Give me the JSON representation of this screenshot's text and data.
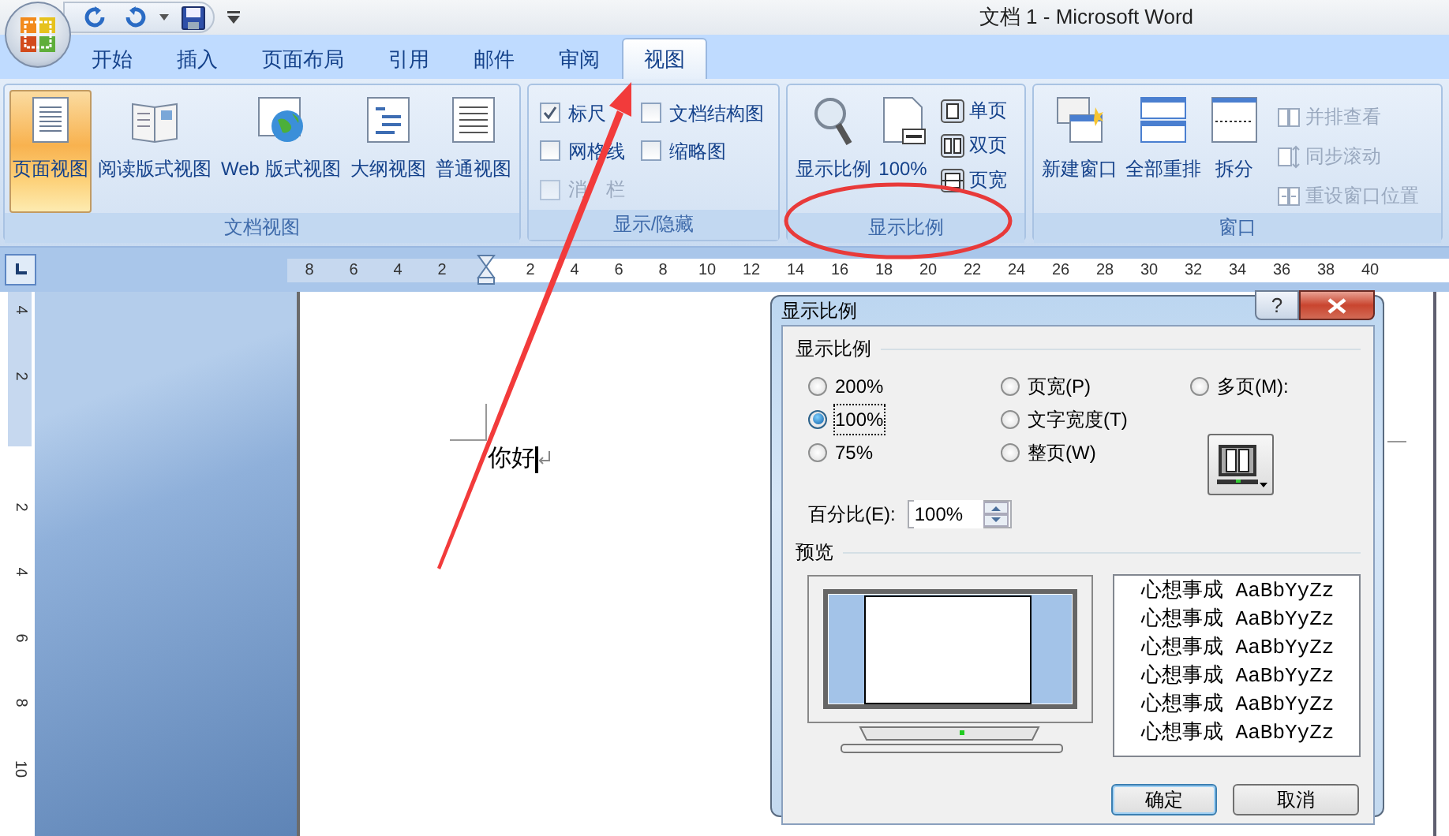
{
  "window": {
    "title": "文档 1 - Microsoft Word"
  },
  "tabs": [
    {
      "label": "开始",
      "selected": false
    },
    {
      "label": "插入",
      "selected": false
    },
    {
      "label": "页面布局",
      "selected": false
    },
    {
      "label": "引用",
      "selected": false
    },
    {
      "label": "邮件",
      "selected": false
    },
    {
      "label": "审阅",
      "selected": false
    },
    {
      "label": "视图",
      "selected": true
    }
  ],
  "ribbon": {
    "groups": [
      {
        "label": "文档视图",
        "items": [
          {
            "kind": "large",
            "label": "页面视图",
            "selected": true
          },
          {
            "kind": "large",
            "label": "阅读版式视图",
            "selected": false
          },
          {
            "kind": "large",
            "label": "Web 版式视图",
            "selected": false
          },
          {
            "kind": "large",
            "label": "大纲视图",
            "selected": false
          },
          {
            "kind": "large",
            "label": "普通视图",
            "selected": false
          }
        ]
      },
      {
        "label": "显示/隐藏",
        "items": [
          {
            "kind": "checkbox",
            "label": "标尺",
            "checked": true,
            "disabled": false
          },
          {
            "kind": "checkbox",
            "label": "文档结构图",
            "checked": false,
            "disabled": false
          },
          {
            "kind": "checkbox",
            "label": "网格线",
            "checked": false,
            "disabled": false
          },
          {
            "kind": "checkbox",
            "label": "缩略图",
            "checked": false,
            "disabled": false
          },
          {
            "kind": "checkbox",
            "label": "消　栏",
            "checked": false,
            "disabled": true
          }
        ]
      },
      {
        "label": "显示比例",
        "items": [
          {
            "kind": "large",
            "label": "显示比例"
          },
          {
            "kind": "large",
            "label": "100%"
          },
          {
            "kind": "small",
            "label": "单页"
          },
          {
            "kind": "small",
            "label": "双页"
          },
          {
            "kind": "small",
            "label": "页宽"
          }
        ]
      },
      {
        "label": "窗口",
        "items": [
          {
            "kind": "large",
            "label": "新建窗口",
            "disabled": false
          },
          {
            "kind": "large",
            "label": "全部重排",
            "disabled": false
          },
          {
            "kind": "large",
            "label": "拆分",
            "disabled": false
          },
          {
            "kind": "small",
            "label": "并排查看",
            "disabled": true
          },
          {
            "kind": "small",
            "label": "同步滚动",
            "disabled": true
          },
          {
            "kind": "small",
            "label": "重设窗口位置",
            "disabled": true
          }
        ]
      }
    ]
  },
  "horizontal_ruler": {
    "left_numbers": [
      "8",
      "6",
      "4",
      "2"
    ],
    "right_numbers": [
      "2",
      "4",
      "6",
      "8",
      "10",
      "12",
      "14",
      "16",
      "18",
      "20",
      "22",
      "24",
      "26",
      "28",
      "30",
      "32",
      "34",
      "36",
      "38",
      "40"
    ]
  },
  "vertical_ruler": {
    "top_numbers": [
      "4",
      "2"
    ],
    "bottom_numbers": [
      "2",
      "4",
      "6",
      "8",
      "10"
    ]
  },
  "document": {
    "text": "你好"
  },
  "dialog": {
    "title": "显示比例",
    "help": "?",
    "zoom_section": {
      "label": "显示比例",
      "options": [
        {
          "label": "200%",
          "selected": false
        },
        {
          "label": "100%",
          "selected": true
        },
        {
          "label": "75%",
          "selected": false
        },
        {
          "label": "页宽(P)",
          "selected": false
        },
        {
          "label": "文字宽度(T)",
          "selected": false
        },
        {
          "label": "整页(W)",
          "selected": false
        },
        {
          "label": "多页(M):",
          "selected": false
        }
      ]
    },
    "percent": {
      "label": "百分比(E):",
      "value": "100%"
    },
    "preview": {
      "label": "预览",
      "sample_lines": [
        "心想事成 AaBbYyZz",
        "心想事成 AaBbYyZz",
        "心想事成 AaBbYyZz",
        "心想事成 AaBbYyZz",
        "心想事成 AaBbYyZz",
        "心想事成 AaBbYyZz"
      ]
    },
    "buttons": [
      {
        "label": "确定",
        "default": true
      },
      {
        "label": "取消",
        "default": false
      }
    ]
  }
}
